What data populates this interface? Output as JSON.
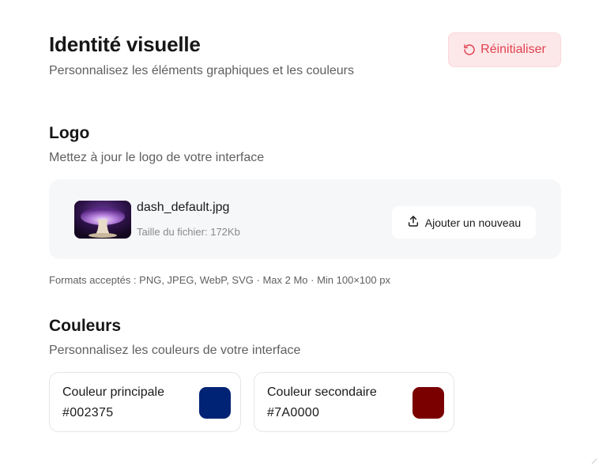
{
  "header": {
    "title": "Identité visuelle",
    "subtitle": "Personnalisez les éléments graphiques et les couleurs",
    "reset_label": "Réinitialiser",
    "reset_icon": "rotate-ccw-icon"
  },
  "logo": {
    "title": "Logo",
    "description": "Mettez à jour le logo de votre interface",
    "file_name": "dash_default.jpg",
    "file_size": "Taille du fichier: 172Kb",
    "upload_label": "Ajouter un nouveau",
    "upload_icon": "upload-icon",
    "formats_note": "Formats acceptés : PNG, JPEG, WebP, SVG · Max 2 Mo · Min 100×100 px"
  },
  "colors": {
    "title": "Couleurs",
    "description": "Personnalisez les couleurs de votre interface",
    "primary": {
      "label": "Couleur principale",
      "value": "#002375",
      "color": "#002375"
    },
    "secondary": {
      "label": "Couleur secondaire",
      "value": "#7A0000",
      "color": "#7A0000"
    }
  },
  "theme": {
    "danger_text": "#e0424f",
    "danger_bg": "#fde8e9",
    "card_bg": "#f6f7f9"
  }
}
